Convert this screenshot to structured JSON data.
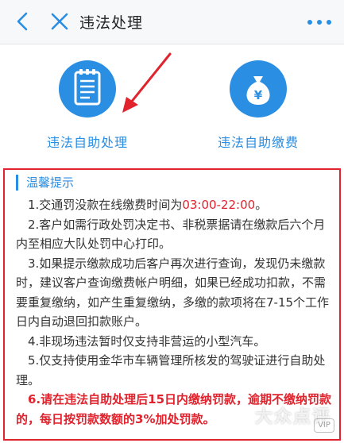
{
  "header": {
    "title": "违法处理"
  },
  "actions": [
    {
      "label": "违法自助处理",
      "icon": "document-icon"
    },
    {
      "label": "违法自助缴费",
      "icon": "money-bag-icon"
    }
  ],
  "notice": {
    "heading": "温馨提示",
    "item1_prefix": "1.交通罚没款在线缴费时间为",
    "item1_time": "03:00-22:00",
    "item1_suffix": "。",
    "item2": "2.客户如需行政处罚决定书、非税票据请在缴款后六个月内至相应大队处罚中心打印。",
    "item3": "3.如果提示缴款成功后客户再次进行查询，发现仍未缴款时，建议客户查询缴费帐户明细，如果已经成功扣款，不需要重复缴纳，如产生重复缴纳，多缴的款项将在7-15个工作日内自动退回扣款账户。",
    "item4": "4.非现场违法暂时仅支持非营运的小型汽车。",
    "item5": "5.仅支持使用金华市车辆管理所核发的驾驶证进行自助处理。",
    "item6": "6.请在违法自助处理后15日内缴纳罚款，逾期不缴纳罚款的，每日按罚款数额的3%加处罚款。"
  },
  "watermark": "大众点评",
  "badge": "VIP",
  "colors": {
    "accent": "#2a8ee2",
    "alert": "#e0232d"
  }
}
